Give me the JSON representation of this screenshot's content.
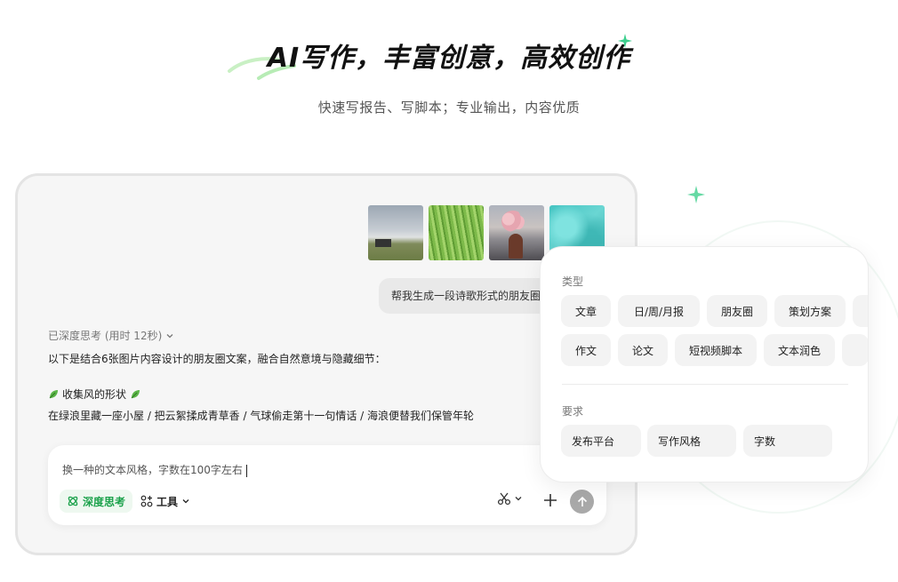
{
  "hero": {
    "title": "AI写作，丰富创意，高效创作",
    "subtitle": "快速写报告、写脚本；专业输出，内容优质"
  },
  "chat": {
    "user_message": "帮我生成一段诗歌形式的朋友圈",
    "thinking_label": "已深度思考 (用时 12秒)",
    "answer_intro": "以下是结合6张图片内容设计的朋友圈文案，融合自然意境与隐藏细节：",
    "answer_heading": "收集风的形状",
    "answer_body": "在绿浪里藏一座小屋 / 把云絮揉成青草香 / 气球偷走第十一句情话 / 海浪便替我们保管年轮"
  },
  "input": {
    "text": "换一种的文本风格，字数在100字左右",
    "deep_think_label": "深度思考",
    "tools_label": "工具"
  },
  "panel": {
    "type_label": "类型",
    "type_row1": [
      "文章",
      "日/周/月报",
      "朋友圈",
      "策划方案"
    ],
    "type_row2": [
      "作文",
      "论文",
      "短视频脚本",
      "文本润色"
    ],
    "requirement_label": "要求",
    "requirements": [
      "发布平台",
      "写作风格",
      "字数"
    ]
  },
  "colors": {
    "accent": "#1aa14a",
    "sparkle": "#3ccf8e",
    "card_bg": "#f6f6f6",
    "chip_bg": "#f3f3f3",
    "send_disabled": "#a9a9a9"
  }
}
